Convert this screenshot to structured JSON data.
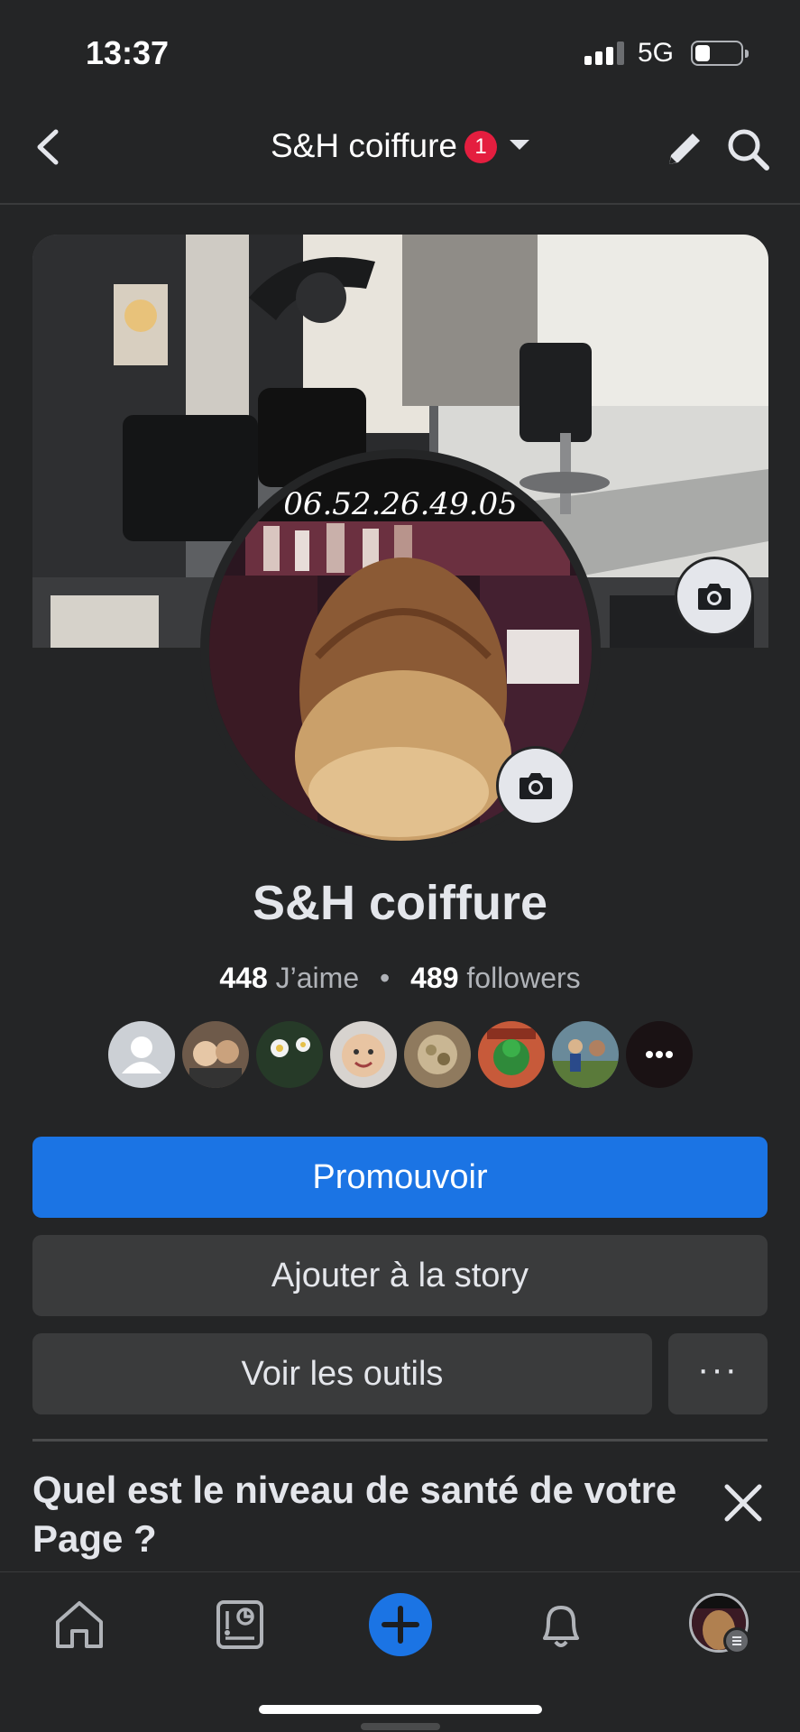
{
  "status_bar": {
    "time": "13:37",
    "network": "5G"
  },
  "header": {
    "title": "S&H coiffure",
    "notification_count": "1"
  },
  "cover": {
    "phone_text": "06.52.26.49.05"
  },
  "page": {
    "name": "S&H coiffure",
    "likes_count": "448",
    "likes_label": "J’aime",
    "separator": "•",
    "followers_count": "489",
    "followers_label": "followers"
  },
  "buttons": {
    "promote": "Promouvoir",
    "add_story": "Ajouter à la story",
    "view_tools": "Voir les outils",
    "more": "···"
  },
  "health_card": {
    "title": "Quel est le niveau de santé de votre Page ?"
  },
  "bottom_nav": [
    "home",
    "insights",
    "create",
    "notifications",
    "profile"
  ],
  "colors": {
    "background": "#242526",
    "primary": "#1b74e4",
    "secondary_button": "#3a3b3c",
    "badge": "#e41e3f",
    "text": "#e4e6eb",
    "muted_text": "#b0b3b8"
  },
  "icons": [
    "back-icon",
    "caret-down-icon",
    "edit-icon",
    "search-icon",
    "camera-icon",
    "close-icon",
    "home-icon",
    "insights-icon",
    "plus-icon",
    "bell-icon"
  ]
}
